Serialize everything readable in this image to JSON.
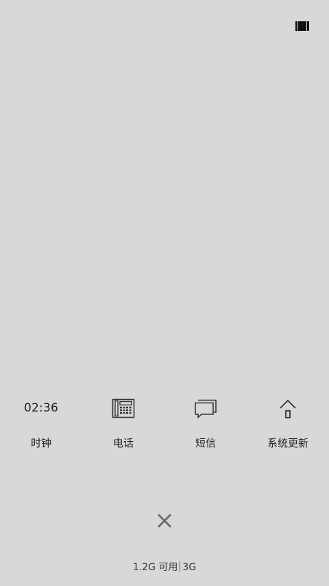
{
  "top_bar": {
    "multiwindow_icon": "multi-window-icon"
  },
  "apps": [
    {
      "label": "时钟",
      "icon_text": "02:36",
      "icon": "clock-text"
    },
    {
      "label": "电话",
      "icon": "phone-icon"
    },
    {
      "label": "短信",
      "icon": "messages-icon"
    },
    {
      "label": "系统更新",
      "icon": "system-update-icon"
    }
  ],
  "close": {
    "icon": "close-icon"
  },
  "memory": {
    "available": "1.2G 可用",
    "total": "3G"
  },
  "colors": {
    "background": "#d8d8d8",
    "text": "#222222",
    "close_icon": "#6a6a6a"
  }
}
